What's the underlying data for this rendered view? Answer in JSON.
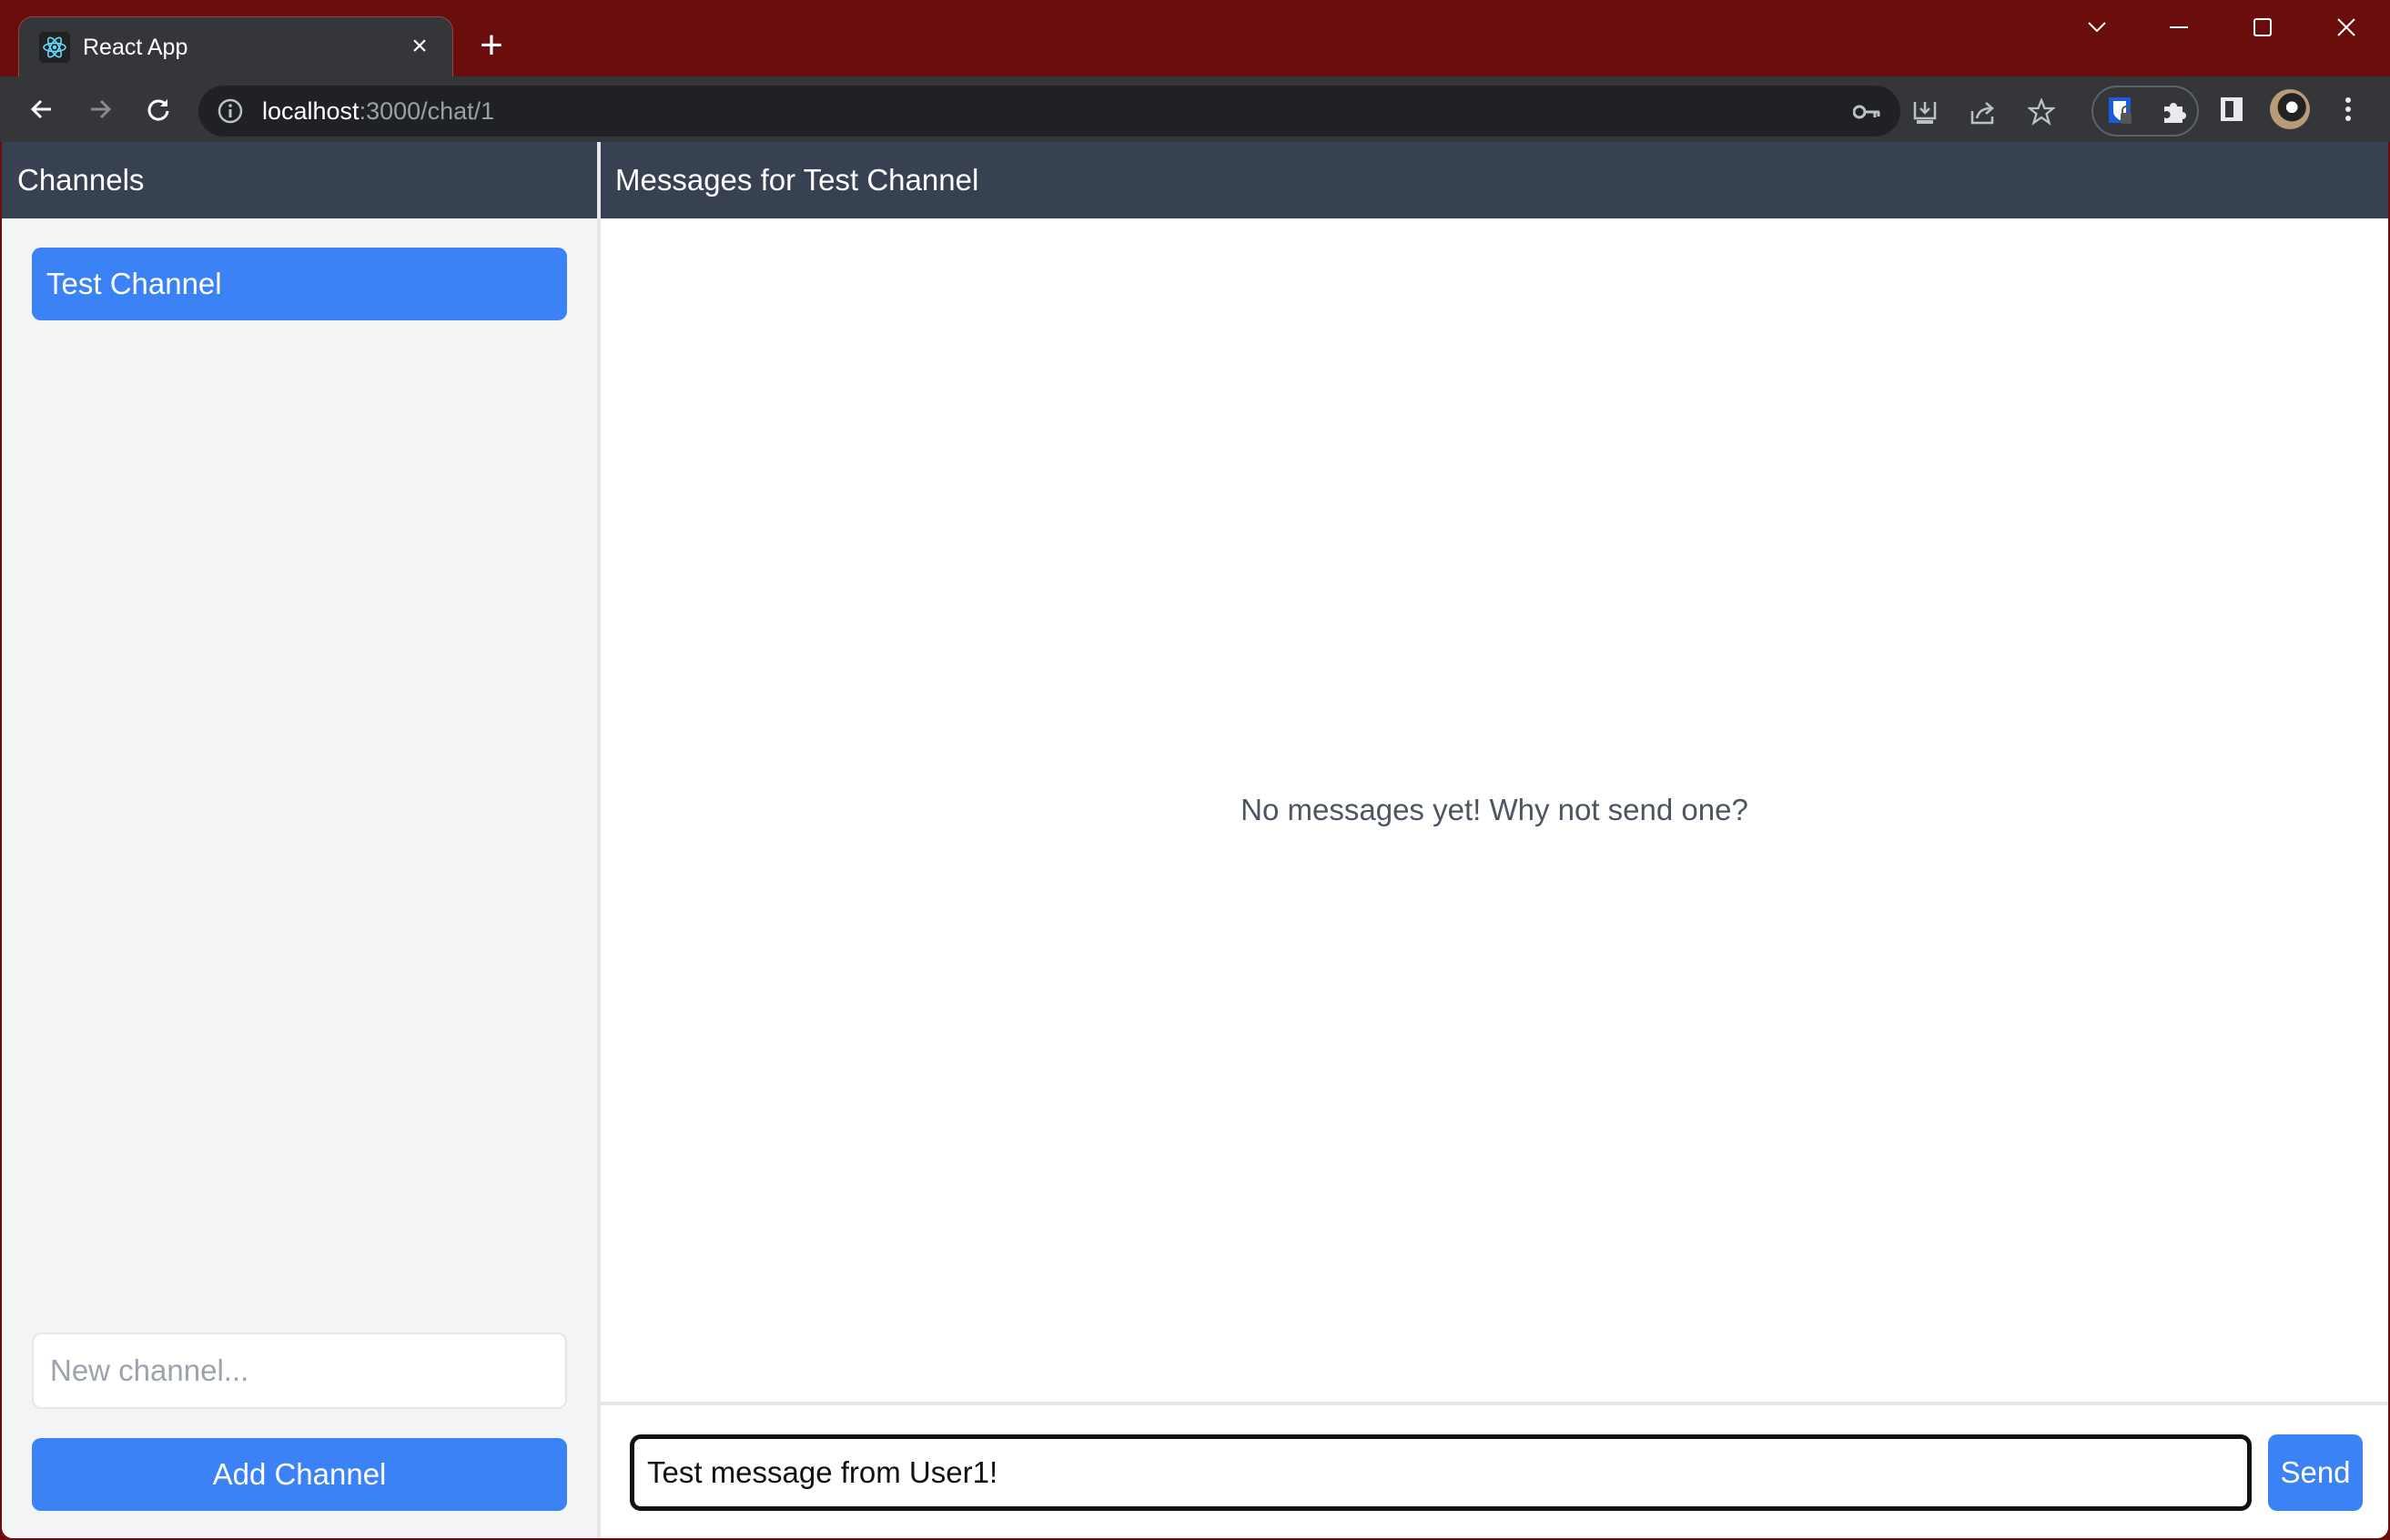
{
  "browser": {
    "tab": {
      "title": "React App",
      "favicon": "react-logo-icon",
      "close_glyph": "×"
    },
    "new_tab_glyph": "+",
    "window_controls": {
      "tab_search": "chevron-down-icon",
      "minimize": "minimize-icon",
      "maximize": "maximize-icon",
      "close": "close-icon"
    },
    "omnibox": {
      "host": "localhost",
      "rest": ":3000/chat/1"
    },
    "omnibox_icons": [
      "key-icon",
      "install-icon",
      "share-icon",
      "star-icon"
    ],
    "toolbar_icons": [
      "bitwarden-icon",
      "extensions-icon",
      "side-panel-icon",
      "profile-avatar",
      "menu-icon"
    ]
  },
  "sidebar": {
    "title": "Channels",
    "channels": [
      {
        "name": "Test Channel",
        "active": true
      }
    ],
    "new_channel": {
      "placeholder": "New channel...",
      "value": ""
    },
    "add_button": "Add Channel"
  },
  "main": {
    "title": "Messages for Test Channel",
    "empty_state": "No messages yet! Why not send one?",
    "composer": {
      "value": "Test message from User1!",
      "send_label": "Send"
    }
  },
  "colors": {
    "titlebar": "#6b0d0d",
    "header": "#374151",
    "accent": "#3b82f6",
    "sidebar_bg": "#f3f4f6"
  }
}
